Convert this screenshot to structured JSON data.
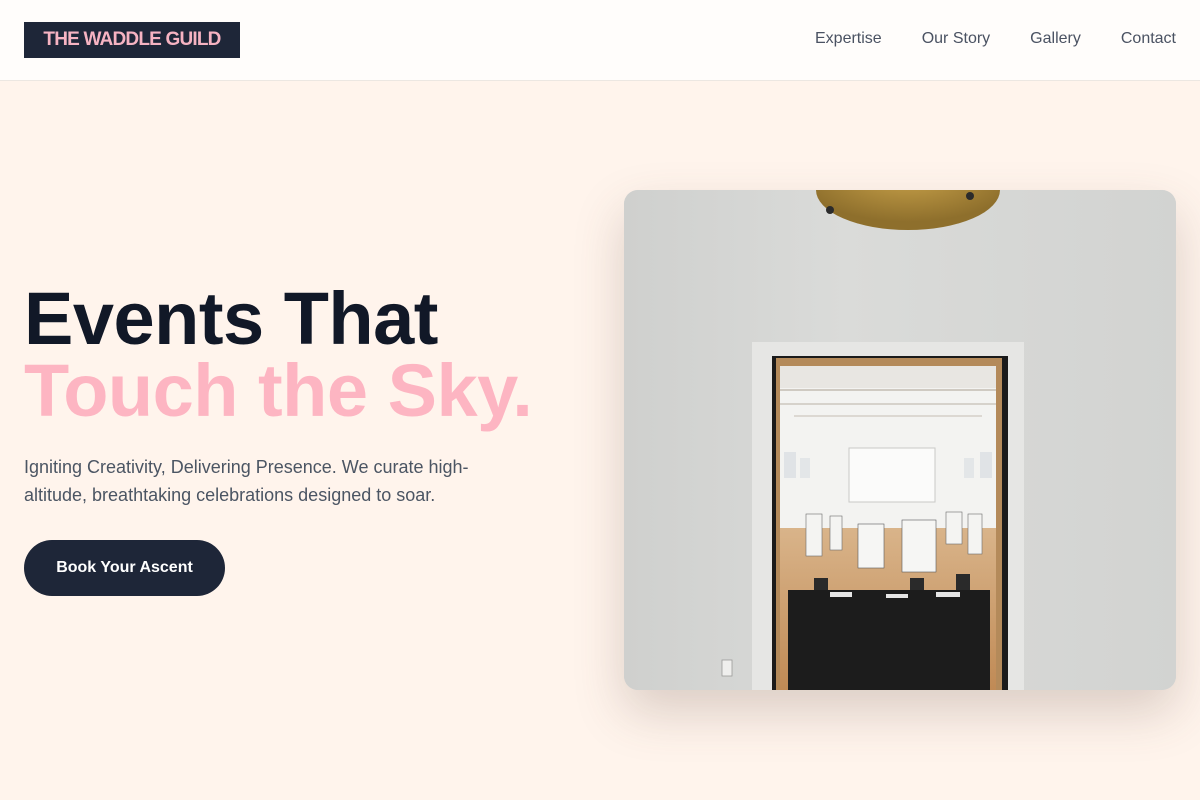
{
  "header": {
    "logo_text": "THE WADDLE GUILD",
    "nav": [
      "Expertise",
      "Our Story",
      "Gallery",
      "Contact"
    ]
  },
  "hero": {
    "headline_line1": "Events That",
    "headline_line2": "Touch the Sky.",
    "subtitle": "Igniting Creativity, Delivering Presence. We curate high-altitude, breathtaking celebrations designed to soar.",
    "cta_label": "Book Your Ascent"
  },
  "colors": {
    "brand_dark": "#1e2638",
    "accent_pink": "#fdb5c2",
    "background": "#fff4ec"
  }
}
